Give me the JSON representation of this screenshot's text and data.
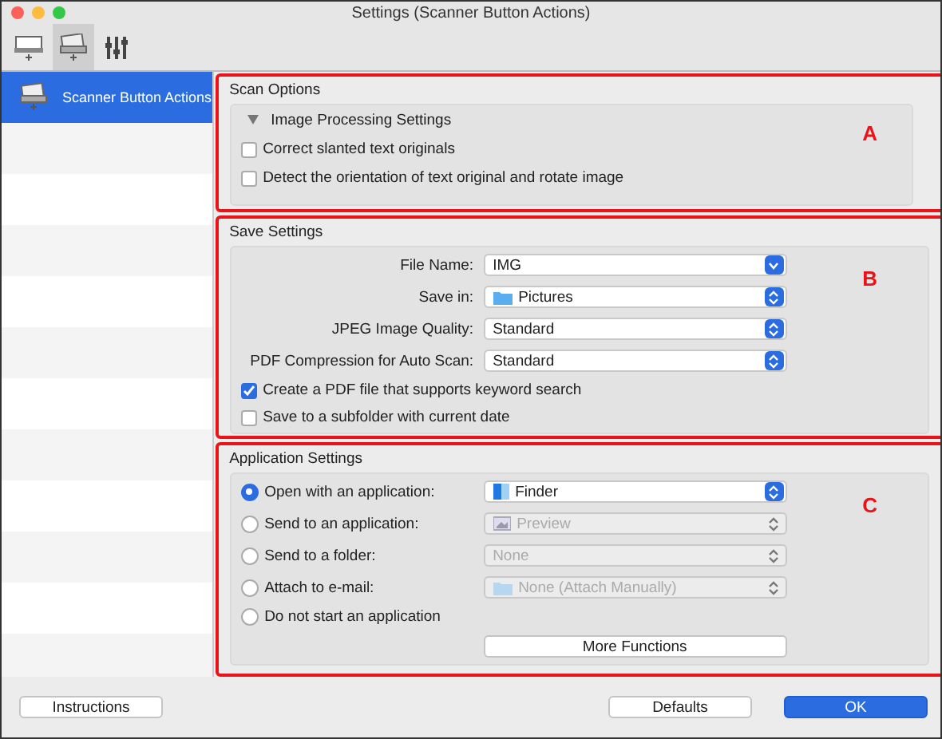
{
  "window": {
    "title": "Settings (Scanner Button Actions)"
  },
  "toolbar": [
    {
      "kind": "scanner",
      "selected": false
    },
    {
      "kind": "scanner-button",
      "selected": true
    },
    {
      "kind": "tools",
      "selected": false
    }
  ],
  "sidebar": {
    "items": [
      {
        "label": "Scanner Button Actions",
        "selected": true
      }
    ]
  },
  "scan_options": {
    "title": "Scan Options",
    "marker": "A",
    "group": {
      "title": "Image Processing Settings",
      "expanded": true
    },
    "checkboxes": [
      {
        "label": "Correct slanted text originals",
        "checked": false
      },
      {
        "label": "Detect the orientation of text original and rotate image",
        "checked": false
      }
    ]
  },
  "save_settings": {
    "title": "Save Settings",
    "marker": "B",
    "fields": [
      {
        "label": "File Name:",
        "value": "IMG",
        "kind": "combo"
      },
      {
        "label": "Save in:",
        "value": "Pictures",
        "kind": "folder"
      },
      {
        "label": "JPEG Image Quality:",
        "value": "Standard",
        "kind": "popup"
      },
      {
        "label": "PDF Compression for Auto Scan:",
        "value": "Standard",
        "kind": "popup"
      }
    ],
    "checkboxes": [
      {
        "label": "Create a PDF file that supports keyword search",
        "checked": true
      },
      {
        "label": "Save to a subfolder with current date",
        "checked": false
      }
    ]
  },
  "application_settings": {
    "title": "Application Settings",
    "marker": "C",
    "options": [
      {
        "label": "Open with an application:",
        "selected": true,
        "value": "Finder",
        "kind": "finder",
        "disabled": false
      },
      {
        "label": "Send to an application:",
        "selected": false,
        "value": "Preview",
        "kind": "preview",
        "disabled": true
      },
      {
        "label": "Send to a folder:",
        "selected": false,
        "value": "None",
        "kind": "plain",
        "disabled": true
      },
      {
        "label": "Attach to e-mail:",
        "selected": false,
        "value": "None (Attach Manually)",
        "kind": "mail",
        "disabled": true
      },
      {
        "label": "Do not start an application",
        "selected": false
      }
    ],
    "more_button": "More Functions"
  },
  "footer": {
    "left_button": "Instructions",
    "buttons": [
      {
        "label": "Defaults",
        "default": false
      },
      {
        "label": "OK",
        "default": true
      }
    ]
  }
}
